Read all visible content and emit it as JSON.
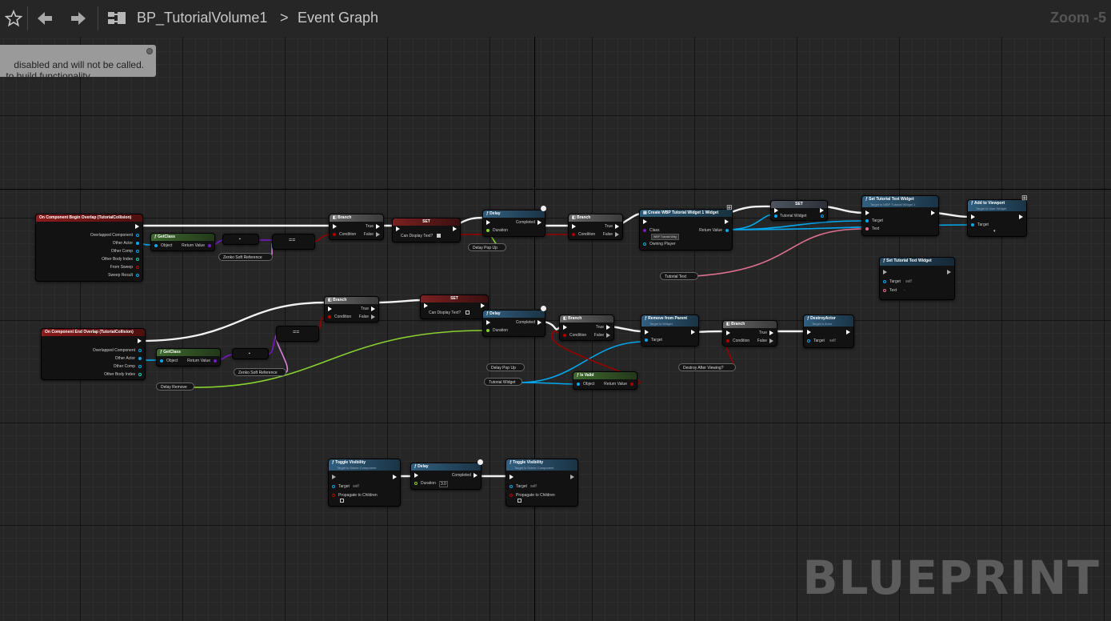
{
  "toolbar": {
    "breadcrumb_blueprint": "BP_TutorialVolume1",
    "breadcrumb_separator": ">",
    "breadcrumb_graph": "Event Graph",
    "zoom": "Zoom -5"
  },
  "comment": {
    "text": "disabled and will not be called.\n to build functionality."
  },
  "watermark": "BLUEPRINT",
  "nodes": {
    "begin_overlap": {
      "title": "On Component Begin Overlap (TutorialCollision)",
      "pins": [
        "Overlapped Component",
        "Other Actor",
        "Other Comp",
        "Other Body Index",
        "From Sweep",
        "Sweep Result"
      ]
    },
    "getclass1": {
      "title": "GetClass",
      "in": "Object",
      "out": "Return Value"
    },
    "eq1": {
      "label": "=="
    },
    "soft_ref1": {
      "label": "Zenko Soft Reference"
    },
    "branch1": {
      "title": "Branch",
      "condition": "Condition",
      "true": "True",
      "false": "False"
    },
    "set1": {
      "title": "SET",
      "label": "Can Display Text?"
    },
    "delay1": {
      "title": "Delay",
      "completed": "Completed",
      "duration": "Duration"
    },
    "delay_popup1": {
      "label": "Delay Pop Up"
    },
    "branch2": {
      "title": "Branch",
      "condition": "Condition",
      "true": "True",
      "false": "False"
    },
    "create_widget": {
      "title": "Create WBP Tutorial Widget 1 Widget",
      "class": "Class",
      "class_value": "WBP Tutorial Wdg",
      "owning": "Owning Player",
      "return": "Return Value"
    },
    "set_widget": {
      "title": "SET",
      "label": "Tutorial Widget"
    },
    "set_tutorial_text": {
      "title": "Set Tutorial Text Widget",
      "subtitle": "Target is WBP Tutorial Widget 1",
      "target": "Target",
      "text": "Text"
    },
    "add_viewport": {
      "title": "Add to Viewport",
      "subtitle": "Target is User Widget",
      "target": "Target"
    },
    "tutorial_text_var": {
      "label": "Tutorial Text"
    },
    "set_tutorial_text2": {
      "title": "Set Tutorial Text Widget",
      "target": "Target",
      "target_value": "self",
      "text": "Text",
      "text_value": "-"
    },
    "end_overlap": {
      "title": "On Component End Overlap (TutorialCollision)",
      "pins": [
        "Overlapped Component",
        "Other Actor",
        "Other Comp",
        "Other Body Index"
      ]
    },
    "getclass2": {
      "title": "GetClass",
      "in": "Object",
      "out": "Return Value"
    },
    "eq2": {
      "label": "=="
    },
    "soft_ref2": {
      "label": "Zenko Soft Reference"
    },
    "delay_remove": {
      "label": "Delay Remove"
    },
    "branch3": {
      "title": "Branch",
      "condition": "Condition",
      "true": "True",
      "false": "False"
    },
    "set2": {
      "title": "SET",
      "label": "Can Display Text?"
    },
    "delay2": {
      "title": "Delay",
      "completed": "Completed",
      "duration": "Duration"
    },
    "delay_popup2": {
      "label": "Delay Pop Up"
    },
    "tutorial_widget_var": {
      "label": "Tutorial Widget"
    },
    "branch4": {
      "title": "Branch",
      "condition": "Condition",
      "true": "True",
      "false": "False"
    },
    "is_valid": {
      "title": "Is Valid",
      "in": "Object",
      "out": "Return Value"
    },
    "remove_parent": {
      "title": "Remove from Parent",
      "subtitle": "Target is Widget",
      "target": "Target"
    },
    "branch5": {
      "title": "Branch",
      "condition": "Condition",
      "true": "True",
      "false": "False"
    },
    "destroy_after": {
      "label": "Destroy After Viewing?"
    },
    "destroy_actor": {
      "title": "DestroyActor",
      "subtitle": "Target is Actor",
      "target": "Target",
      "target_value": "self"
    },
    "toggle1": {
      "title": "Toggle Visibility",
      "subtitle": "Target is Scene Component",
      "target": "Target",
      "target_value": "self",
      "propagate": "Propagate to Children"
    },
    "delay3": {
      "title": "Delay",
      "completed": "Completed",
      "duration": "Duration",
      "duration_value": "3.0"
    },
    "toggle2": {
      "title": "Toggle Visibility",
      "subtitle": "Target is Scene Component",
      "target": "Target",
      "target_value": "self",
      "propagate": "Propagate to Children"
    }
  }
}
